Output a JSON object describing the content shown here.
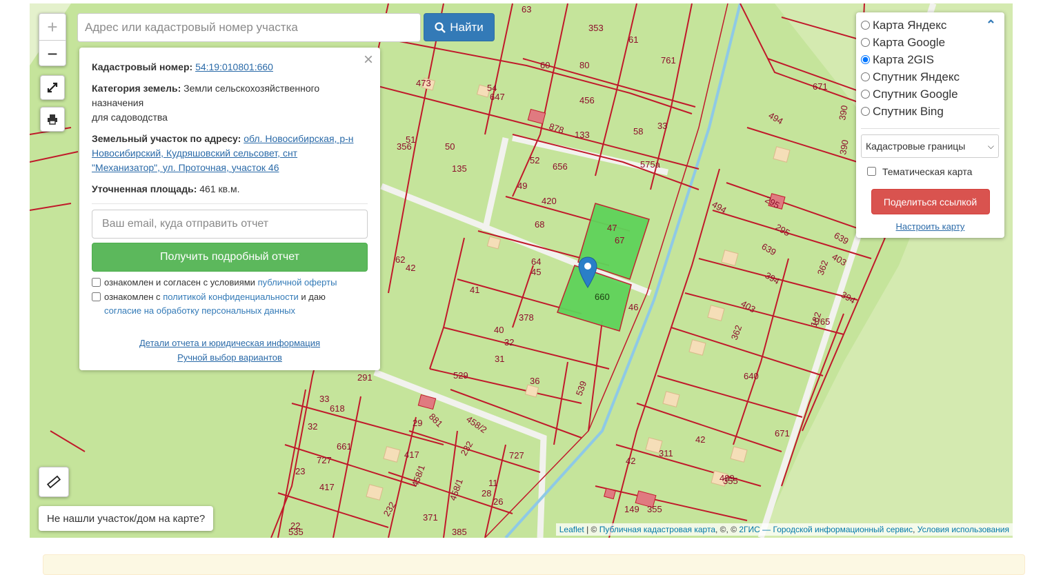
{
  "search": {
    "placeholder": "Адрес или кадастровый номер участка",
    "button_label": "Найти"
  },
  "zoom": {
    "in_label": "+",
    "out_label": "−"
  },
  "info_panel": {
    "close_label": "×",
    "cadastral_label": "Кадастровый номер:",
    "cadastral_value": "54:19:010801:660",
    "category_label": "Категория земель:",
    "category_value": "Земли сельскохозяйственного назначения",
    "category_use": "для садоводства",
    "address_label": "Земельный участок по адресу:",
    "address_value": "обл. Новосибирская, р-н Новосибирский, Кудряшовский сельсовет, снт \"Механизатор\", ул. Проточная, участок 46",
    "area_label": "Уточненная площадь:",
    "area_value": "461 кв.м.",
    "email_placeholder": "Ваш email, куда отправить отчет",
    "report_button": "Получить подробный отчет",
    "consent1_text": "ознакомлен и согласен с условиями",
    "consent1_link": "публичной оферты",
    "consent2_text_a": "ознакомлен с",
    "consent2_link_a": "политикой конфиденциальности",
    "consent2_text_b": "и даю",
    "consent2_link_b": "согласие на обработку персональных данных",
    "details_link": "Детали отчета и юридическая информация",
    "manual_link": "Ручной выбор вариантов"
  },
  "layers": {
    "options": [
      {
        "label": "Карта Яндекс",
        "checked": false
      },
      {
        "label": "Карта Google",
        "checked": false
      },
      {
        "label": "Карта 2GIS",
        "checked": true
      },
      {
        "label": "Спутник Яндекс",
        "checked": false
      },
      {
        "label": "Спутник Google",
        "checked": false
      },
      {
        "label": "Спутник Bing",
        "checked": false
      }
    ],
    "overlay_select": "Кадастровые границы",
    "thematic_label": "Тематическая карта",
    "share_button": "Поделиться ссылкой",
    "config_link": "Настроить карту"
  },
  "not_found": "Не нашли участок/дом на карте?",
  "attribution": {
    "leaflet": "Leaflet",
    "sep1": " | © ",
    "pkk": "Публичная кадастровая карта",
    "sep2": ", ©, © ",
    "gis": "2ГИС — Городской информационный сервис",
    "sep3": ", ",
    "terms": "Условия использования"
  },
  "colors": {
    "map_green": "#c5e49b",
    "parcel_border": "#c0192a",
    "selected_parcel": "#5fd35a",
    "road": "#f4f4f0",
    "stream": "#8ec9e6",
    "pin": "#2a7fc8"
  },
  "plot_numbers": [
    "63",
    "353",
    "61",
    "761",
    "60",
    "80",
    "473",
    "54",
    "647",
    "456",
    "33",
    "58",
    "878",
    "133",
    "575а",
    "356",
    "51",
    "50",
    "52",
    "656",
    "135",
    "49",
    "420",
    "68",
    "47",
    "67",
    "62",
    "42",
    "64",
    "45",
    "660",
    "46",
    "41",
    "378",
    "40",
    "32",
    "31",
    "529",
    "36",
    "539",
    "291",
    "33",
    "618",
    "881",
    "458/2",
    "29",
    "32",
    "661",
    "417",
    "232",
    "727",
    "23",
    "417",
    "458/1",
    "28",
    "727",
    "11",
    "232",
    "458/1",
    "26",
    "371",
    "22",
    "535",
    "385",
    "149",
    "355",
    "42",
    "311",
    "42",
    "355",
    "489",
    "640",
    "362",
    "403",
    "394",
    "639",
    "295",
    "295",
    "639",
    "394",
    "403",
    "362",
    "182",
    "1/65",
    "671",
    "494",
    "671",
    "494",
    "390",
    "390"
  ],
  "selected_plot": "660"
}
